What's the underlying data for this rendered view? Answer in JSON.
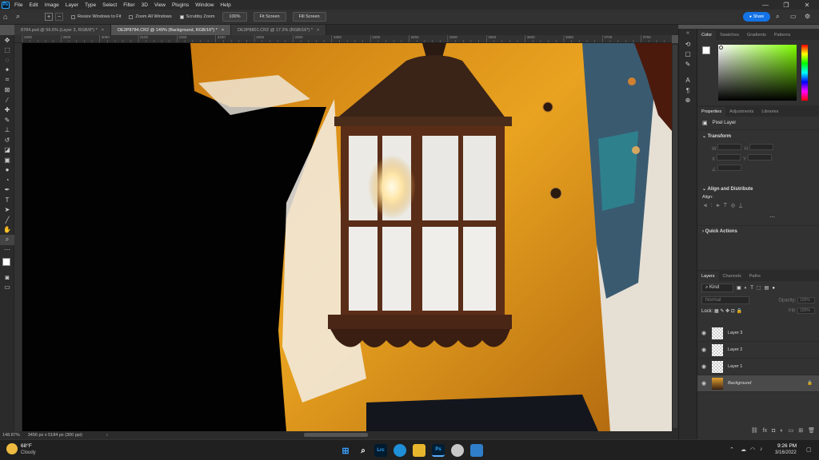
{
  "app": {
    "logo": "Ps",
    "window_controls": {
      "minimize": "—",
      "restore": "❐",
      "close": "✕"
    }
  },
  "menu": [
    "File",
    "Edit",
    "Image",
    "Layer",
    "Type",
    "Select",
    "Filter",
    "3D",
    "View",
    "Plugins",
    "Window",
    "Help"
  ],
  "options": {
    "resize_windows": "Resize Windows to Fit",
    "zoom_all": "Zoom All Windows",
    "scrubby_zoom": "Scrubby Zoom",
    "zoom_pct": "100%",
    "fit_screen": "Fit Screen",
    "fill_screen": "Fill Screen",
    "share": "Share"
  },
  "tabs": [
    {
      "label": "8784.psd @ 56.6% (Layer 3, RGB/8*) *",
      "close": "×"
    },
    {
      "label": "DE3P8784.CR2 @ 149% (Background, RGB/16*) *",
      "close": "×"
    },
    {
      "label": "DE3P8801.CR2 @ 17.2% (RGB/16*) *",
      "close": "×"
    }
  ],
  "ruler_ticks": [
    "2500",
    "3000",
    "3050",
    "3100",
    "3150",
    "3200",
    "3250",
    "3300",
    "3350",
    "3400",
    "3450",
    "3500",
    "3550",
    "3600",
    "3650",
    "3700",
    "3750"
  ],
  "status": {
    "zoom": "148.87%",
    "doc_info": "3456 px x 5184 px (300 ppi)"
  },
  "color_panel": {
    "tabs": [
      "Color",
      "Swatches",
      "Gradients",
      "Patterns"
    ]
  },
  "properties_panel": {
    "tabs": [
      "Properties",
      "Adjustments",
      "Libraries"
    ],
    "layer_type": "Pixel Layer",
    "transform": "Transform",
    "align": "Align and Distribute",
    "align_label": "Align:",
    "quick_actions": "Quick Actions",
    "fields": {
      "w": "W",
      "h": "H",
      "x": "X",
      "y": "Y"
    }
  },
  "layers_panel": {
    "tabs": [
      "Layers",
      "Channels",
      "Paths"
    ],
    "filter_kind": "Kind",
    "blend_mode": "Normal",
    "opacity_label": "Opacity:",
    "opacity": "100%",
    "lock_label": "Lock:",
    "fill_label": "Fill:",
    "fill": "100%",
    "layers": [
      {
        "name": "Layer 3",
        "active": false
      },
      {
        "name": "Layer 2",
        "active": false
      },
      {
        "name": "Layer 1",
        "active": false
      },
      {
        "name": "Background",
        "active": true
      }
    ]
  },
  "taskbar": {
    "weather_temp": "68°F",
    "weather_desc": "Cloudy",
    "time": "9:26 PM",
    "date": "3/16/2022",
    "apps": [
      "Lrc",
      "Ps"
    ]
  }
}
